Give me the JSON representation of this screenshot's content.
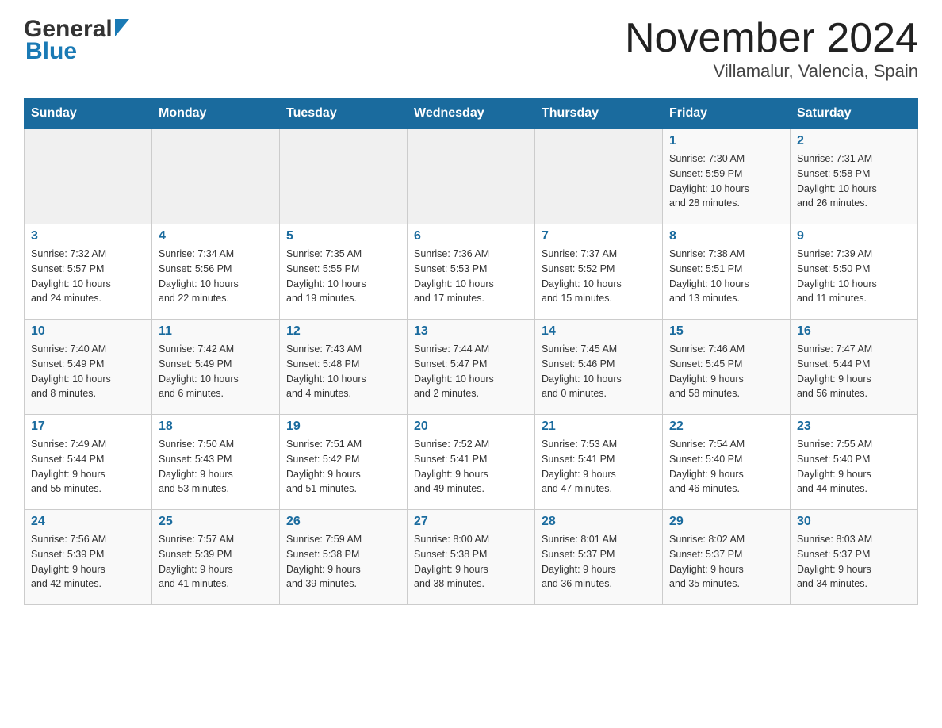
{
  "header": {
    "logo": {
      "general": "General",
      "blue": "Blue"
    },
    "month": "November 2024",
    "location": "Villamalur, Valencia, Spain"
  },
  "days_of_week": [
    "Sunday",
    "Monday",
    "Tuesday",
    "Wednesday",
    "Thursday",
    "Friday",
    "Saturday"
  ],
  "weeks": [
    [
      {
        "day": "",
        "info": ""
      },
      {
        "day": "",
        "info": ""
      },
      {
        "day": "",
        "info": ""
      },
      {
        "day": "",
        "info": ""
      },
      {
        "day": "",
        "info": ""
      },
      {
        "day": "1",
        "info": "Sunrise: 7:30 AM\nSunset: 5:59 PM\nDaylight: 10 hours\nand 28 minutes."
      },
      {
        "day": "2",
        "info": "Sunrise: 7:31 AM\nSunset: 5:58 PM\nDaylight: 10 hours\nand 26 minutes."
      }
    ],
    [
      {
        "day": "3",
        "info": "Sunrise: 7:32 AM\nSunset: 5:57 PM\nDaylight: 10 hours\nand 24 minutes."
      },
      {
        "day": "4",
        "info": "Sunrise: 7:34 AM\nSunset: 5:56 PM\nDaylight: 10 hours\nand 22 minutes."
      },
      {
        "day": "5",
        "info": "Sunrise: 7:35 AM\nSunset: 5:55 PM\nDaylight: 10 hours\nand 19 minutes."
      },
      {
        "day": "6",
        "info": "Sunrise: 7:36 AM\nSunset: 5:53 PM\nDaylight: 10 hours\nand 17 minutes."
      },
      {
        "day": "7",
        "info": "Sunrise: 7:37 AM\nSunset: 5:52 PM\nDaylight: 10 hours\nand 15 minutes."
      },
      {
        "day": "8",
        "info": "Sunrise: 7:38 AM\nSunset: 5:51 PM\nDaylight: 10 hours\nand 13 minutes."
      },
      {
        "day": "9",
        "info": "Sunrise: 7:39 AM\nSunset: 5:50 PM\nDaylight: 10 hours\nand 11 minutes."
      }
    ],
    [
      {
        "day": "10",
        "info": "Sunrise: 7:40 AM\nSunset: 5:49 PM\nDaylight: 10 hours\nand 8 minutes."
      },
      {
        "day": "11",
        "info": "Sunrise: 7:42 AM\nSunset: 5:49 PM\nDaylight: 10 hours\nand 6 minutes."
      },
      {
        "day": "12",
        "info": "Sunrise: 7:43 AM\nSunset: 5:48 PM\nDaylight: 10 hours\nand 4 minutes."
      },
      {
        "day": "13",
        "info": "Sunrise: 7:44 AM\nSunset: 5:47 PM\nDaylight: 10 hours\nand 2 minutes."
      },
      {
        "day": "14",
        "info": "Sunrise: 7:45 AM\nSunset: 5:46 PM\nDaylight: 10 hours\nand 0 minutes."
      },
      {
        "day": "15",
        "info": "Sunrise: 7:46 AM\nSunset: 5:45 PM\nDaylight: 9 hours\nand 58 minutes."
      },
      {
        "day": "16",
        "info": "Sunrise: 7:47 AM\nSunset: 5:44 PM\nDaylight: 9 hours\nand 56 minutes."
      }
    ],
    [
      {
        "day": "17",
        "info": "Sunrise: 7:49 AM\nSunset: 5:44 PM\nDaylight: 9 hours\nand 55 minutes."
      },
      {
        "day": "18",
        "info": "Sunrise: 7:50 AM\nSunset: 5:43 PM\nDaylight: 9 hours\nand 53 minutes."
      },
      {
        "day": "19",
        "info": "Sunrise: 7:51 AM\nSunset: 5:42 PM\nDaylight: 9 hours\nand 51 minutes."
      },
      {
        "day": "20",
        "info": "Sunrise: 7:52 AM\nSunset: 5:41 PM\nDaylight: 9 hours\nand 49 minutes."
      },
      {
        "day": "21",
        "info": "Sunrise: 7:53 AM\nSunset: 5:41 PM\nDaylight: 9 hours\nand 47 minutes."
      },
      {
        "day": "22",
        "info": "Sunrise: 7:54 AM\nSunset: 5:40 PM\nDaylight: 9 hours\nand 46 minutes."
      },
      {
        "day": "23",
        "info": "Sunrise: 7:55 AM\nSunset: 5:40 PM\nDaylight: 9 hours\nand 44 minutes."
      }
    ],
    [
      {
        "day": "24",
        "info": "Sunrise: 7:56 AM\nSunset: 5:39 PM\nDaylight: 9 hours\nand 42 minutes."
      },
      {
        "day": "25",
        "info": "Sunrise: 7:57 AM\nSunset: 5:39 PM\nDaylight: 9 hours\nand 41 minutes."
      },
      {
        "day": "26",
        "info": "Sunrise: 7:59 AM\nSunset: 5:38 PM\nDaylight: 9 hours\nand 39 minutes."
      },
      {
        "day": "27",
        "info": "Sunrise: 8:00 AM\nSunset: 5:38 PM\nDaylight: 9 hours\nand 38 minutes."
      },
      {
        "day": "28",
        "info": "Sunrise: 8:01 AM\nSunset: 5:37 PM\nDaylight: 9 hours\nand 36 minutes."
      },
      {
        "day": "29",
        "info": "Sunrise: 8:02 AM\nSunset: 5:37 PM\nDaylight: 9 hours\nand 35 minutes."
      },
      {
        "day": "30",
        "info": "Sunrise: 8:03 AM\nSunset: 5:37 PM\nDaylight: 9 hours\nand 34 minutes."
      }
    ]
  ]
}
